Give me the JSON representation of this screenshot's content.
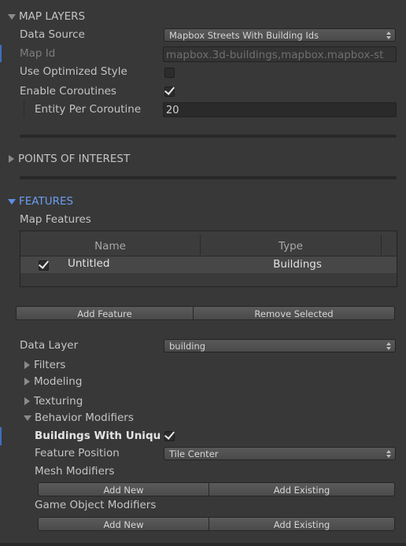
{
  "map_layers": {
    "title": "MAP LAYERS",
    "data_source_label": "Data Source",
    "data_source_value": "Mapbox Streets With Building Ids",
    "map_id_label": "Map Id",
    "map_id_value": "mapbox.3d-buildings,mapbox.mapbox-st",
    "optimized_label": "Use Optimized Style",
    "optimized_checked": false,
    "coroutines_label": "Enable Coroutines",
    "coroutines_checked": true,
    "entity_label": "Entity Per Coroutine",
    "entity_value": "20"
  },
  "poi": {
    "title": "POINTS OF INTEREST"
  },
  "features": {
    "title": "FEATURES",
    "map_features_label": "Map Features",
    "table": {
      "columns": [
        "Name",
        "Type"
      ],
      "rows": [
        {
          "checked": true,
          "name": "Untitled",
          "type": "Buildings"
        }
      ]
    },
    "add_feature": "Add Feature",
    "remove_selected": "Remove Selected",
    "data_layer_label": "Data Layer",
    "data_layer_value": "building",
    "filters": "Filters",
    "modeling": "Modeling",
    "texturing": "Texturing",
    "behavior_modifiers": "Behavior Modifiers",
    "unique_label": "Buildings With Uniqu",
    "unique_checked": true,
    "feature_position_label": "Feature Position",
    "feature_position_value": "Tile Center",
    "mesh_modifiers_label": "Mesh Modifiers",
    "mesh_add_new": "Add New",
    "mesh_add_existing": "Add Existing",
    "go_modifiers_label": "Game Object Modifiers",
    "go_add_new": "Add New",
    "go_add_existing": "Add Existing"
  },
  "colors": {
    "background": "#383838",
    "accent": "#6a9ef0",
    "text": "#c4c4c4"
  }
}
